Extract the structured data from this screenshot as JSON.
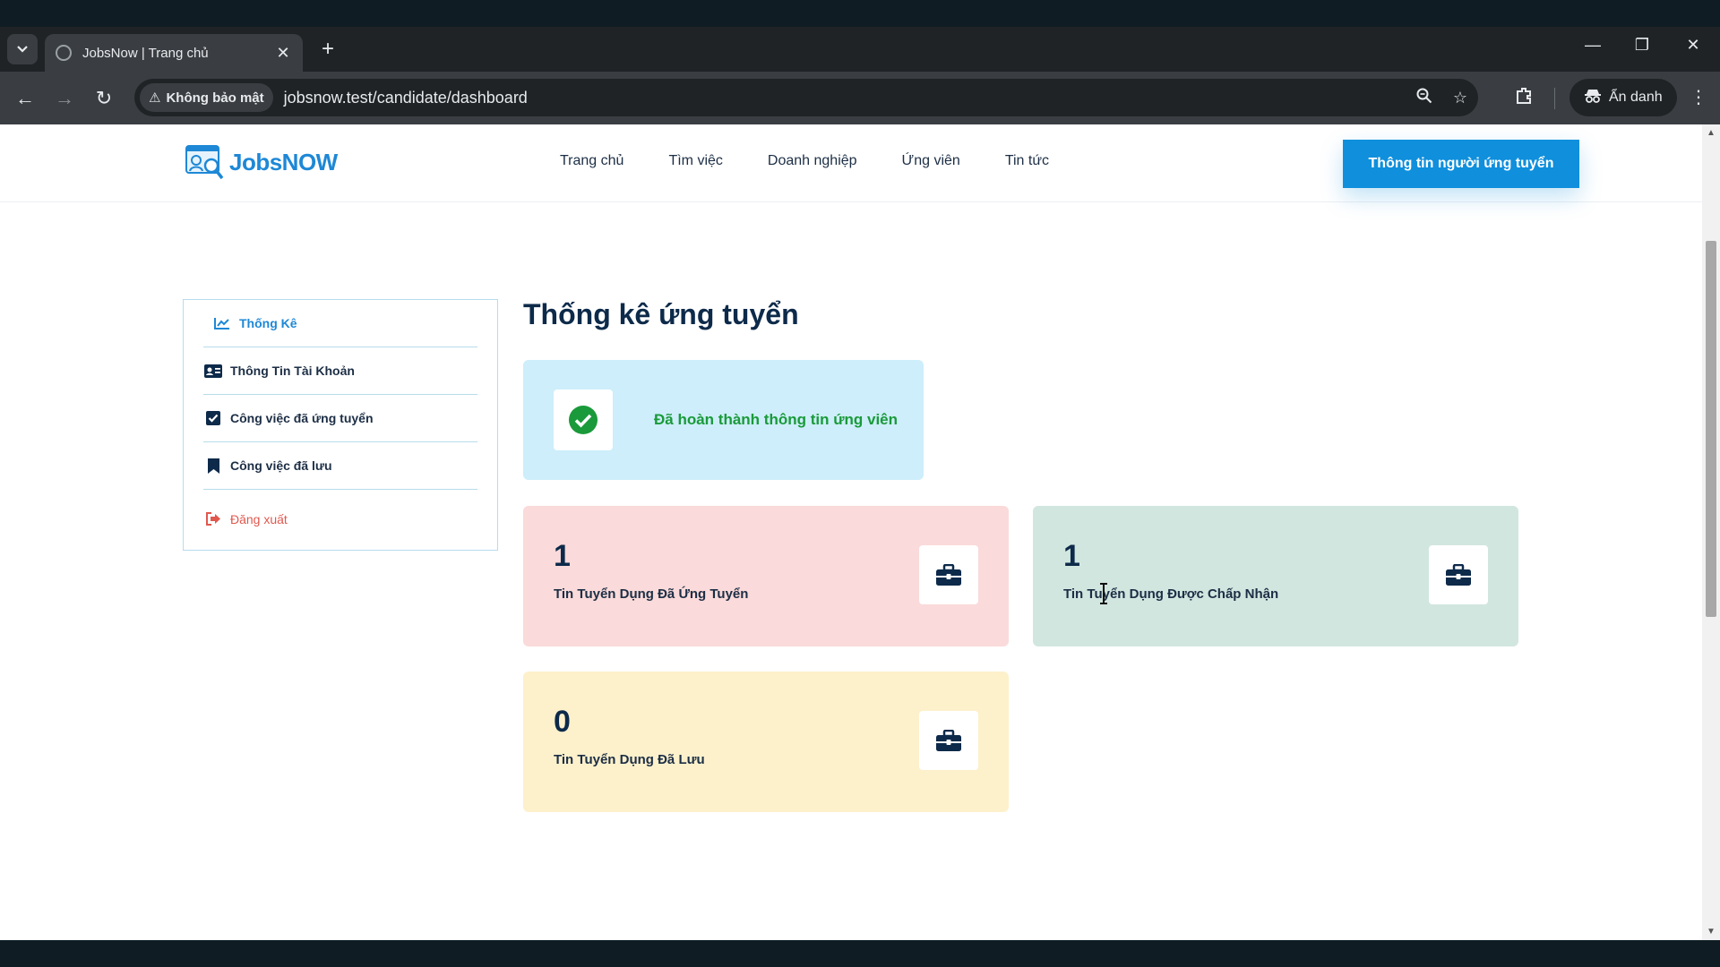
{
  "browser": {
    "tab_title": "JobsNow | Trang chủ",
    "tab_close": "✕",
    "new_tab": "+",
    "security_label": "Không bảo mật",
    "url": "jobsnow.test/candidate/dashboard",
    "incognito_label": "Ẩn danh"
  },
  "header": {
    "logo_text": "JobsNOW",
    "nav": [
      "Trang chủ",
      "Tìm việc",
      "Doanh nghiệp",
      "Ứng viên",
      "Tin tức"
    ],
    "cta_label": "Thông tin người ứng tuyển"
  },
  "sidebar": {
    "items": [
      {
        "label": "Thống Kê",
        "icon": "chart-line-icon"
      },
      {
        "label": "Thông Tin Tài Khoản",
        "icon": "id-card-icon"
      },
      {
        "label": "Công việc đã ứng tuyển",
        "icon": "checkbox-icon"
      },
      {
        "label": "Công việc đã lưu",
        "icon": "bookmark-icon"
      },
      {
        "label": "Đăng xuất",
        "icon": "logout-icon"
      }
    ]
  },
  "main": {
    "title": "Thống kê ứng tuyển",
    "complete_message": "Đã hoàn thành thông tin ứng viên",
    "stats": [
      {
        "value": "1",
        "label": "Tin Tuyển Dụng Đã Ứng Tuyển",
        "color": "#fadada"
      },
      {
        "value": "1",
        "label": "Tin Tuyển Dụng Được Chấp Nhận",
        "color": "#d1e6df"
      },
      {
        "value": "0",
        "label": "Tin Tuyển Dụng Đã Lưu",
        "color": "#fdf1cc"
      }
    ]
  },
  "colors": {
    "accent": "#0f8fdc",
    "success": "#1a9a3a",
    "navy": "#0d2a4a",
    "logout": "#e0584e"
  }
}
